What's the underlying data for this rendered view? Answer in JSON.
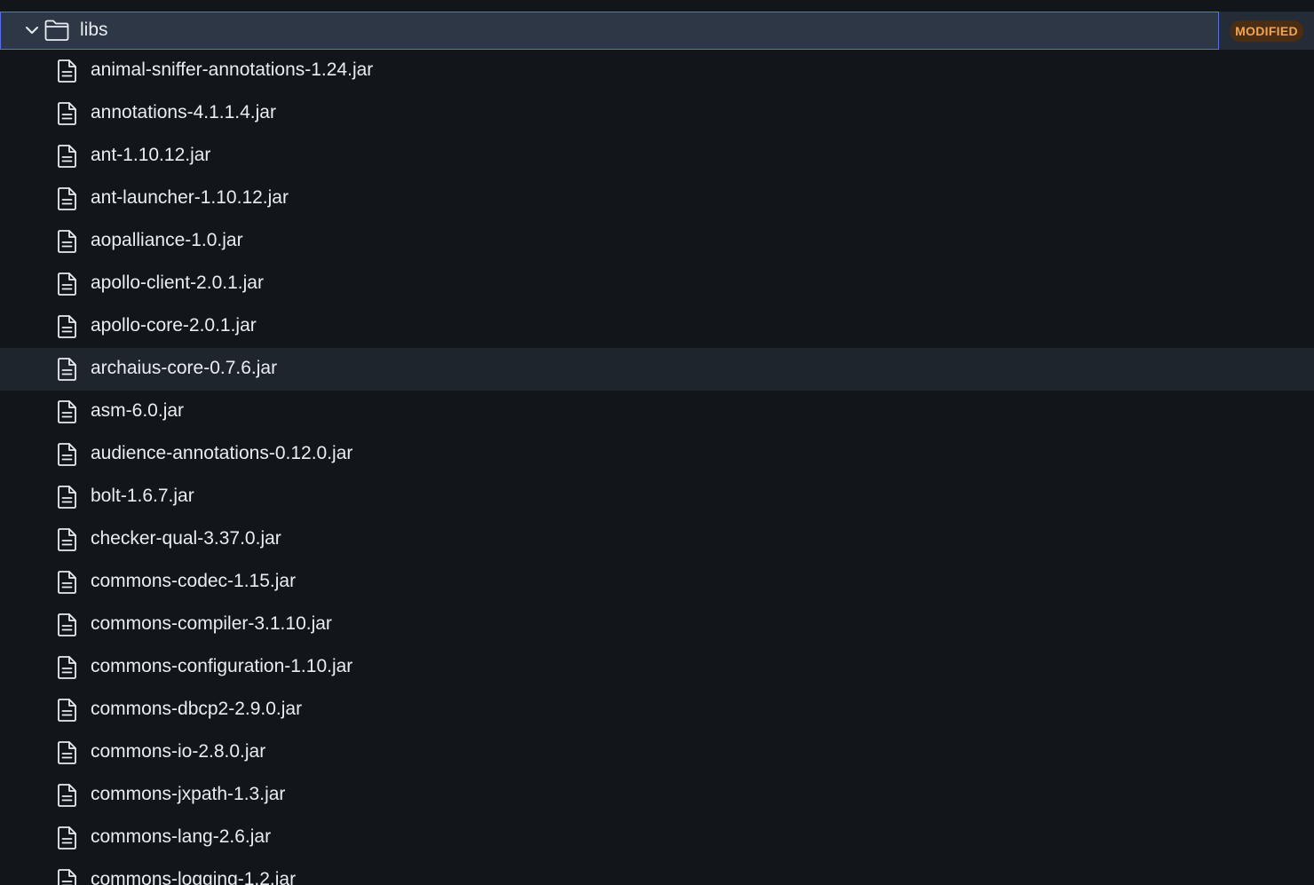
{
  "colors": {
    "background": "#12161b",
    "selected_row": "#2d3745",
    "selected_border": "#5a6fe0",
    "hover_row": "#1f252d",
    "text": "#e9edf2",
    "badge_bg": "#4a2d12",
    "badge_text": "#f0a456"
  },
  "folder": {
    "name": "libs",
    "expanded": true,
    "selected": true,
    "icon": "folder-icon",
    "toggle_icon": "chevron-down-icon",
    "badge": "MODIFIED"
  },
  "file_icon": "file-text-icon",
  "hovered_index": 7,
  "files": [
    "animal-sniffer-annotations-1.24.jar",
    "annotations-4.1.1.4.jar",
    "ant-1.10.12.jar",
    "ant-launcher-1.10.12.jar",
    "aopalliance-1.0.jar",
    "apollo-client-2.0.1.jar",
    "apollo-core-2.0.1.jar",
    "archaius-core-0.7.6.jar",
    "asm-6.0.jar",
    "audience-annotations-0.12.0.jar",
    "bolt-1.6.7.jar",
    "checker-qual-3.37.0.jar",
    "commons-codec-1.15.jar",
    "commons-compiler-3.1.10.jar",
    "commons-configuration-1.10.jar",
    "commons-dbcp2-2.9.0.jar",
    "commons-io-2.8.0.jar",
    "commons-jxpath-1.3.jar",
    "commons-lang-2.6.jar",
    "commons-logging-1.2.jar"
  ]
}
